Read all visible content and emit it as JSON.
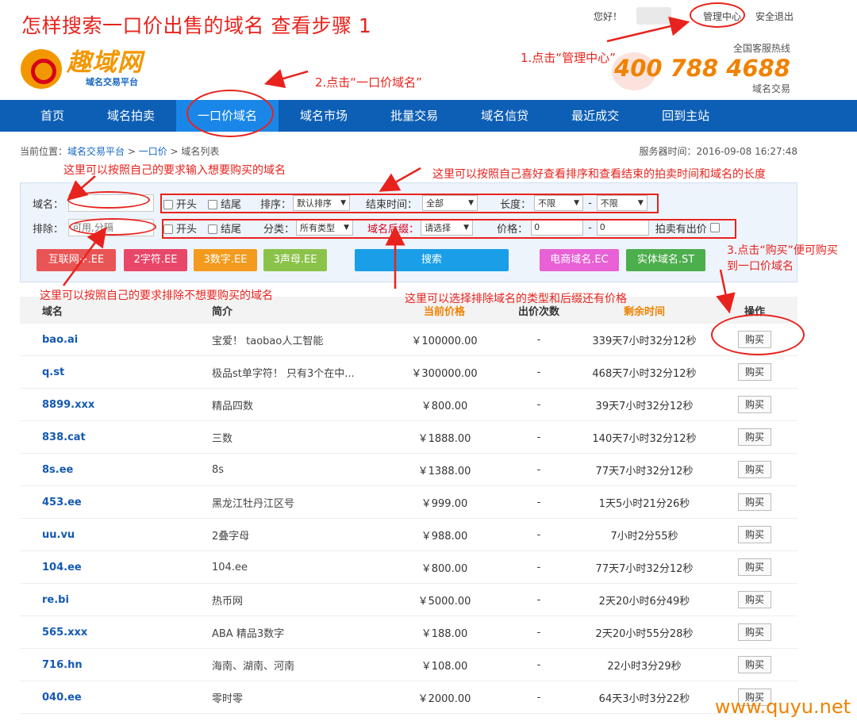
{
  "tutorial_title": "怎样搜索一口价出售的域名 查看步骤 1",
  "top": {
    "greeting": "您好！",
    "manage_center": "管理中心",
    "logout": "安全退出"
  },
  "logo": {
    "name": "趣域网",
    "subtitle": "域名交易平台"
  },
  "hotline": {
    "label": "全国客服热线",
    "number": "400 788 4688",
    "sub": "域名交易"
  },
  "nav": [
    "首页",
    "域名拍卖",
    "一口价域名",
    "域名市场",
    "批量交易",
    "域名信贷",
    "最近成交",
    "回到主站"
  ],
  "nav_active_index": 2,
  "breadcrumb": {
    "prefix": "当前位置：",
    "l1": "域名交易平台",
    "l2": "一口价",
    "l3": "域名列表",
    "sep": " > "
  },
  "server_time": "服务器时间：2016-09-08 16:27:48",
  "filter": {
    "row1": {
      "label": "域名：",
      "value": "",
      "opt_head": "开头",
      "opt_tail": "结尾",
      "sort_label": "排序：",
      "sort_value": "默认排序",
      "end_label": "结束时间：",
      "end_value": "全部",
      "len_label": "长度：",
      "len_from": "不限",
      "len_dash": "-",
      "len_to": "不限"
    },
    "row2": {
      "label": "排除：",
      "placeholder": "可用,分隔",
      "opt_head": "开头",
      "opt_tail": "结尾",
      "type_label": "分类：",
      "type_value": "所有类型",
      "suffix_label": "域名后缀：",
      "suffix_value": "请选择",
      "price_label": "价格：",
      "price_from": "0",
      "price_dash": "-",
      "price_to": "0",
      "has_bid_label": "拍卖有出价"
    },
    "quick_buttons": [
      {
        "label": "互联网+.EE",
        "color": "#e95454"
      },
      {
        "label": "2字符.EE",
        "color": "#e8476a"
      },
      {
        "label": "3数字.EE",
        "color": "#f39b1f"
      },
      {
        "label": "3声母.EE",
        "color": "#8bc34a"
      }
    ],
    "search_label": "搜索",
    "right_buttons": [
      {
        "label": "电商域名.EC",
        "color": "#e861d6"
      },
      {
        "label": "实体域名.ST",
        "color": "#4cae4c"
      }
    ]
  },
  "table": {
    "headers": [
      "域名",
      "简介",
      "当前价格",
      "出价次数",
      "剩余时间",
      "操作"
    ],
    "buy_label": "购买",
    "rows": [
      {
        "domain": "bao.ai",
        "desc": "宝爱！ taobao人工智能",
        "price": "￥100000.00",
        "bids": "-",
        "remaining": "339天7小时32分12秒"
      },
      {
        "domain": "q.st",
        "desc": "极品st单字符！ 只有3个在中...",
        "price": "￥300000.00",
        "bids": "-",
        "remaining": "468天7小时32分12秒"
      },
      {
        "domain": "8899.xxx",
        "desc": "精品四数",
        "price": "￥800.00",
        "bids": "-",
        "remaining": "39天7小时32分12秒"
      },
      {
        "domain": "838.cat",
        "desc": "三数",
        "price": "￥1888.00",
        "bids": "-",
        "remaining": "140天7小时32分12秒"
      },
      {
        "domain": "8s.ee",
        "desc": "8s",
        "price": "￥1388.00",
        "bids": "-",
        "remaining": "77天7小时32分12秒"
      },
      {
        "domain": "453.ee",
        "desc": "黑龙江牡丹江区号",
        "price": "￥999.00",
        "bids": "-",
        "remaining": "1天5小时21分26秒"
      },
      {
        "domain": "uu.vu",
        "desc": "2叠字母",
        "price": "￥988.00",
        "bids": "-",
        "remaining": "7小时2分55秒"
      },
      {
        "domain": "104.ee",
        "desc": "104.ee",
        "price": "￥800.00",
        "bids": "-",
        "remaining": "77天7小时32分12秒"
      },
      {
        "domain": "re.bi",
        "desc": "热币网",
        "price": "￥5000.00",
        "bids": "-",
        "remaining": "2天20小时6分49秒"
      },
      {
        "domain": "565.xxx",
        "desc": "ABA 精品3数字",
        "price": "￥188.00",
        "bids": "-",
        "remaining": "2天20小时55分28秒"
      },
      {
        "domain": "716.hn",
        "desc": "海南、湖南、河南",
        "price": "￥108.00",
        "bids": "-",
        "remaining": "22小时3分29秒"
      },
      {
        "domain": "040.ee",
        "desc": "零时零",
        "price": "￥2000.00",
        "bids": "-",
        "remaining": "64天3小时3分22秒"
      }
    ]
  },
  "annotations": {
    "step1": "1.点击“管理中心”",
    "step2": "2.点击“一口价域名”",
    "step3_line1": "3.点击“购买”便可购买",
    "step3_line2": "到一口价域名",
    "note_input": "这里可以按照自己的要求输入想要购买的域名",
    "note_sort": "这里可以按照自己喜好查看排序和查看结束的拍卖时间和域名的长度",
    "note_exclude": "这里可以按照自己的要求排除不想要购买的域名",
    "note_type": "这里可以选择排除域名的类型和后缀还有价格"
  },
  "watermark": "www.quyu.net",
  "colors": {
    "nav_bg": "#0d5fb5",
    "nav_active": "#1a87e8",
    "annotation_red": "#e8231d",
    "accent_orange": "#f08200",
    "domain_blue": "#1459b3"
  }
}
